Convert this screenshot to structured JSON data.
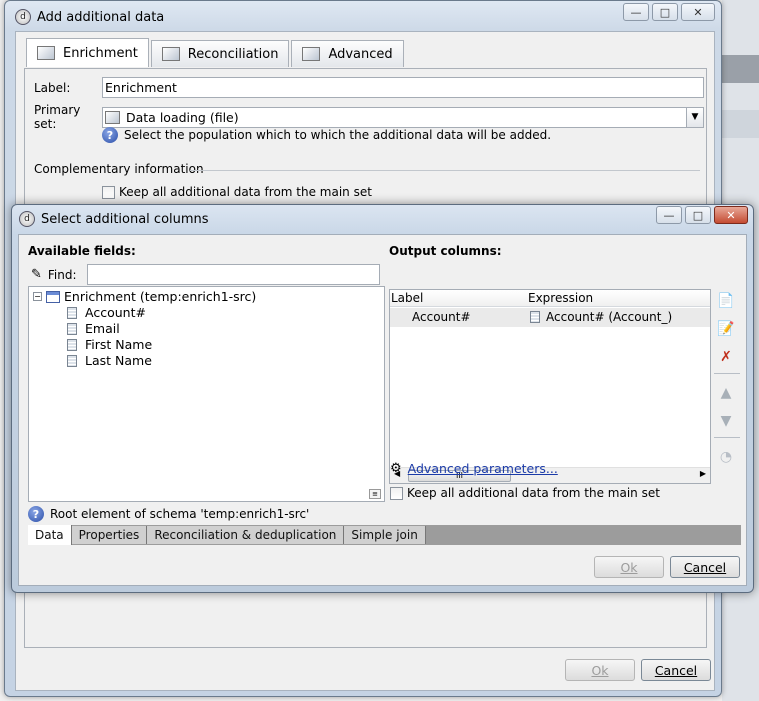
{
  "outer": {
    "title": "Add additional data",
    "caption": {
      "minimize": "—",
      "maximize": "□",
      "close": "✕"
    },
    "tabs": [
      {
        "label": "Enrichment",
        "icon": "enrichment-icon"
      },
      {
        "label": "Reconciliation",
        "icon": "reconciliation-icon"
      },
      {
        "label": "Advanced",
        "icon": "advanced-icon"
      }
    ],
    "label_caption": "Label:",
    "label_value": "Enrichment",
    "primary_caption": "Primary set:",
    "primary_value": "Data loading (file)",
    "help_text": "Select the population which to which the additional data will be added.",
    "complementary_title": "Complementary information",
    "keep_all_label": "Keep all additional data from the main set",
    "ok_label": "Ok",
    "cancel_label": "Cancel"
  },
  "inner": {
    "title": "Select additional columns",
    "available_title": "Available fields:",
    "find_label": "Find:",
    "find_value": "",
    "tree_root": "Enrichment (temp:enrich1-src)",
    "tree_fields": [
      "Account#",
      "Email",
      "First Name",
      "Last Name"
    ],
    "output_title": "Output columns:",
    "col_label": "Label",
    "col_expression": "Expression",
    "rows": [
      {
        "label": "Account#",
        "expression": "Account# (Account_)"
      }
    ],
    "advanced_link": "Advanced parameters...",
    "keep_all_label": "Keep all additional data from the main set",
    "root_info": "Root element of schema 'temp:enrich1-src'",
    "bottom_tabs": [
      "Data",
      "Properties",
      "Reconciliation & deduplication",
      "Simple join"
    ],
    "ok_label": "Ok",
    "cancel_label": "Cancel",
    "scroll_thumb": "III"
  }
}
